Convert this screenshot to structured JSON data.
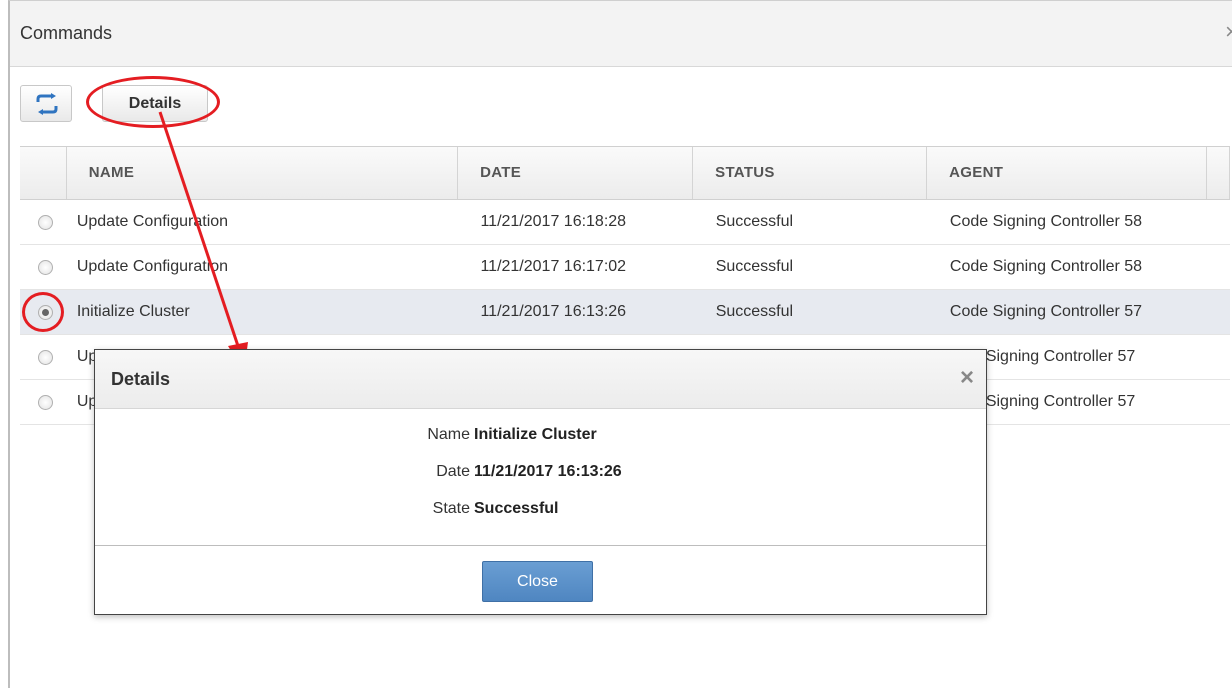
{
  "window": {
    "title": "Commands",
    "close_glyph": "×"
  },
  "toolbar": {
    "refresh_icon": "refresh-icon",
    "details_label": "Details"
  },
  "grid": {
    "columns": [
      "NAME",
      "DATE",
      "STATUS",
      "AGENT",
      ""
    ],
    "rows": [
      {
        "name": "Update Configuration",
        "date": "11/21/2017 16:18:28",
        "status": "Successful",
        "agent": "Code Signing Controller 58",
        "selected": false
      },
      {
        "name": "Update Configuration",
        "date": "11/21/2017 16:17:02",
        "status": "Successful",
        "agent": "Code Signing Controller 58",
        "selected": false
      },
      {
        "name": "Initialize Cluster",
        "date": "11/21/2017 16:13:26",
        "status": "Successful",
        "agent": "Code Signing Controller 57",
        "selected": true
      },
      {
        "name": "Up",
        "date": "",
        "status": "",
        "agent": "Signing Controller 57",
        "selected": false
      },
      {
        "name": "Up",
        "date": "",
        "status": "",
        "agent": "Signing Controller 57",
        "selected": false
      }
    ]
  },
  "dialog": {
    "title": "Details",
    "close_glyph": "×",
    "fields": [
      {
        "label": "Name",
        "value": "Initialize Cluster"
      },
      {
        "label": "Date",
        "value": "11/21/2017 16:13:26"
      },
      {
        "label": "State",
        "value": "Successful"
      }
    ],
    "close_label": "Close"
  },
  "annotations": {
    "color": "#e41d22"
  },
  "colors": {
    "accent_button": "#5b8fc8",
    "selected_row": "#e7eaf0"
  }
}
